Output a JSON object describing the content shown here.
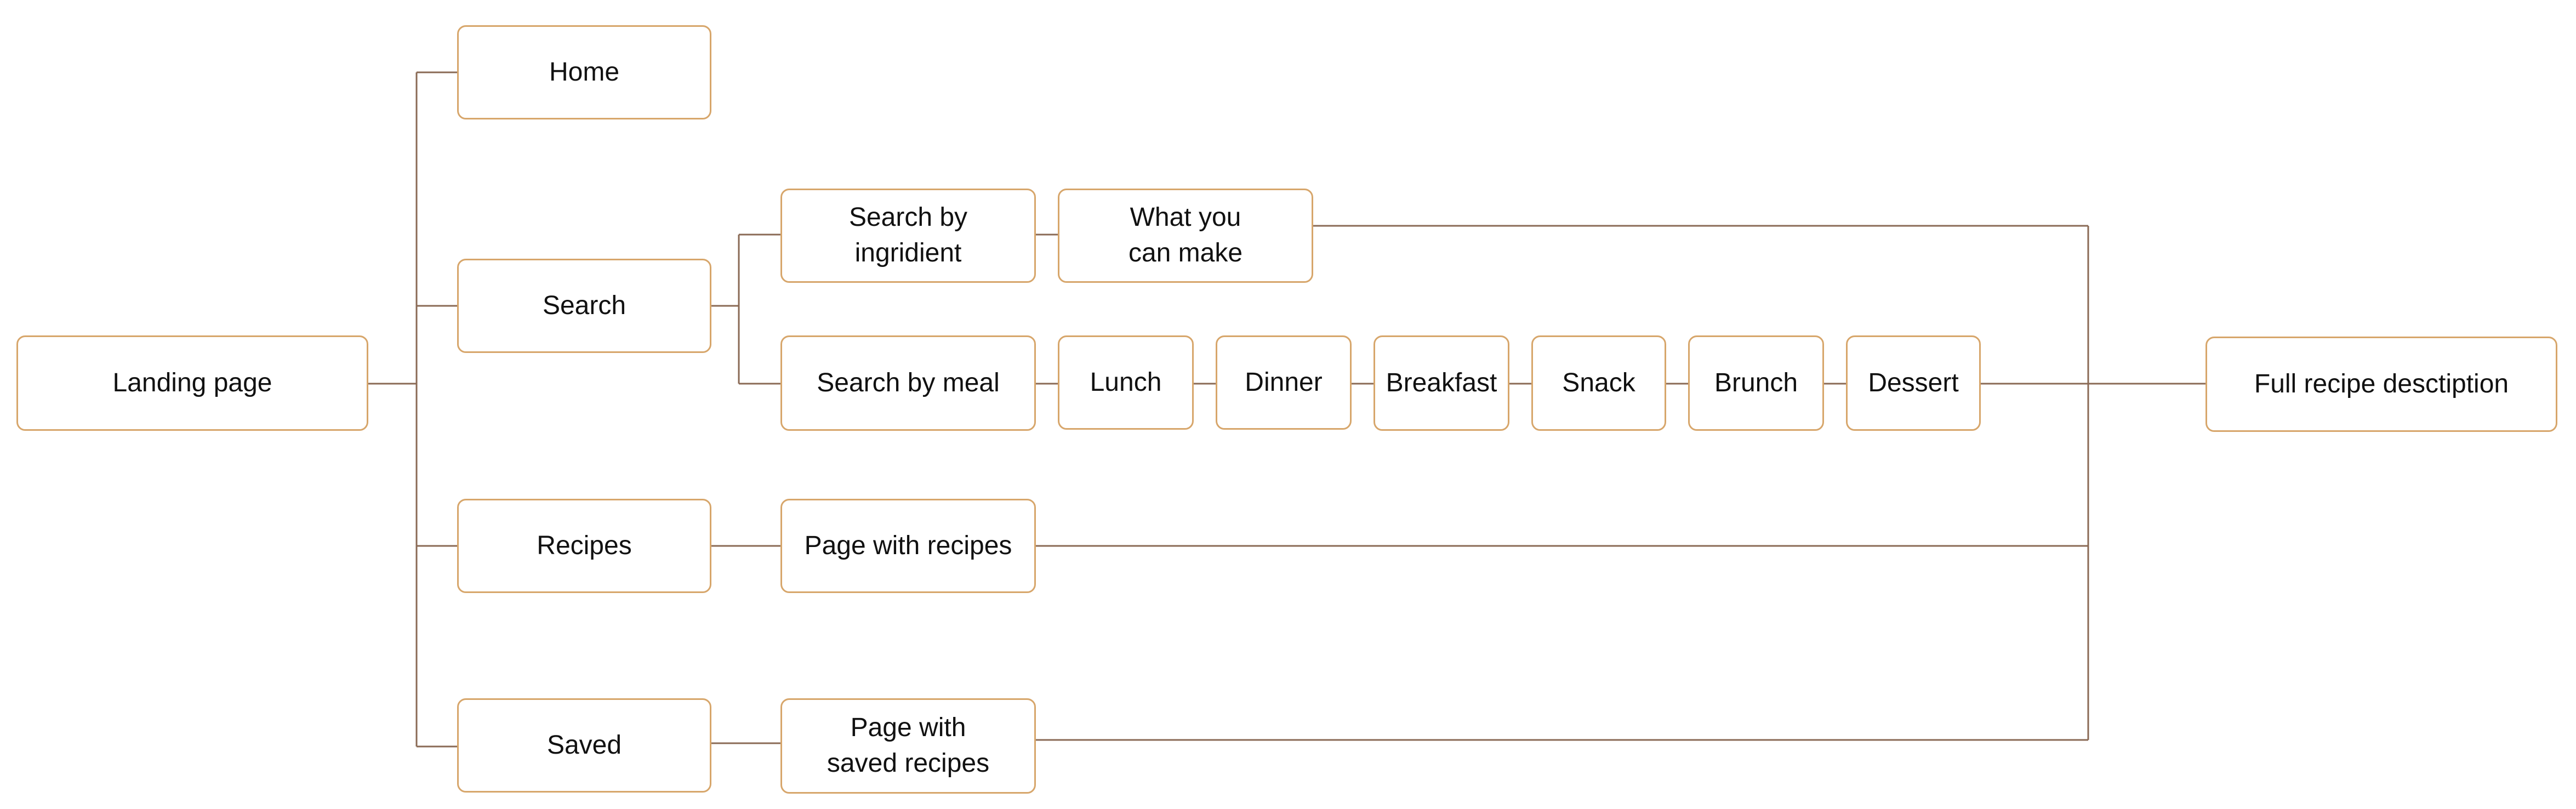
{
  "colors": {
    "node_border": "#d7a66b",
    "connector": "#8a6a55",
    "text": "#111111",
    "background": "#ffffff"
  },
  "nodes": {
    "landing": "Landing page",
    "home": "Home",
    "search": "Search",
    "recipes": "Recipes",
    "saved": "Saved",
    "search_by_ingredient": "Search by\ningridient",
    "what_you_can_make": "What you\ncan make",
    "search_by_meal": "Search by meal",
    "lunch": "Lunch",
    "dinner": "Dinner",
    "breakfast": "Breakfast",
    "snack": "Snack",
    "brunch": "Brunch",
    "dessert": "Dessert",
    "page_with_recipes": "Page with recipes",
    "page_with_saved_recipes": "Page with\nsaved recipes",
    "full_recipe": "Full recipe desctiption"
  }
}
